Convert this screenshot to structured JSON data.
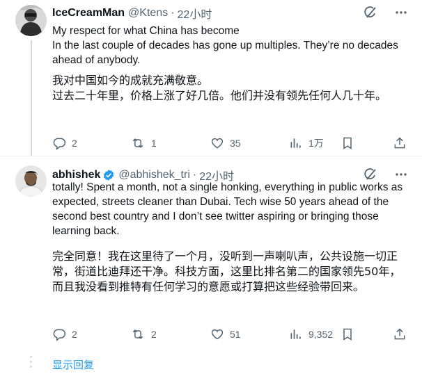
{
  "tweets": [
    {
      "name": "IceCreamMan",
      "handle": "@Ktens",
      "dot": "·",
      "time": "22小时",
      "text_en": [
        "My respect for what China has become",
        "In the last couple of decades has gone up multiples. They’re no decades ahead of anybody."
      ],
      "text_zh": [
        "我对中国如今的成就充满敬意。",
        "过去二十年里，价格上涨了好几倍。他们并没有领先任何人几十年。"
      ],
      "actions": {
        "replies": "2",
        "retweets": "1",
        "likes": "35",
        "views": "1万"
      }
    },
    {
      "name": "abhishek",
      "handle": "@abhishek_tri",
      "dot": "·",
      "time": "22小时",
      "verified": true,
      "text_en": "totally! Spent a month, not a single honking, everything in public works as expected, streets cleaner than Dubai. Tech wise 50 years ahead of the second best country and I don’t see twitter aspiring or bringing those learning back.",
      "text_zh": "完全同意！我在这里待了一个月，没听到一声喇叭声，公共设施一切正常，街道比迪拜还干净。科技方面，这里比排名第二的国家领先50年，而且我没看到推特有任何学习的意愿或打算把这些经验带回来。",
      "actions": {
        "replies": "2",
        "retweets": "2",
        "likes": "51",
        "views": "9,352"
      }
    }
  ],
  "show_replies": "显示回复",
  "icons": [
    "grok-icon",
    "more-icon",
    "reply-icon",
    "retweet-icon",
    "like-icon",
    "views-icon",
    "share-icon",
    "verified-badge-icon"
  ],
  "colors": {
    "accent": "#1d9bf0",
    "muted": "#536471",
    "text": "#0f1419",
    "thread": "#cfd9de"
  }
}
